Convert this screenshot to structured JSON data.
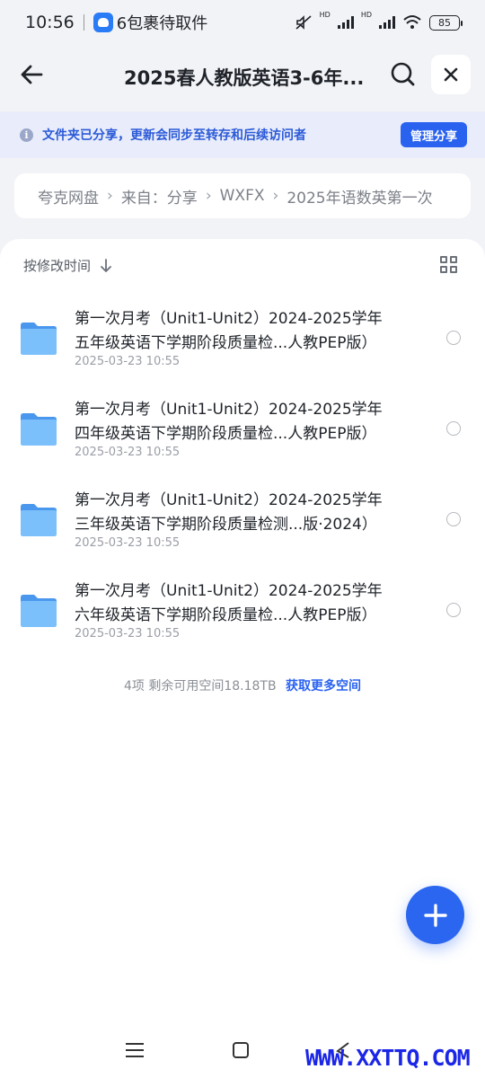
{
  "status_bar": {
    "time": "10:56",
    "notification": "6包裹待取件",
    "battery": "85",
    "hd1": "HD",
    "hd2": "HD"
  },
  "header": {
    "title": "2025春人教版英语3-6年..."
  },
  "notice": {
    "text": "文件夹已分享，更新会同步至转存和后续访问者",
    "button": "管理分享"
  },
  "breadcrumb": {
    "items": [
      "夸克网盘",
      "来自：分享",
      "WXFX",
      "2025年语数英第一次"
    ]
  },
  "sort": {
    "label": "按修改时间"
  },
  "files": [
    {
      "line1": "第一次月考（Unit1-Unit2）2024-2025学年",
      "line2": "五年级英语下学期阶段质量检...人教PEP版）",
      "date": "2025-03-23 10:55"
    },
    {
      "line1": "第一次月考（Unit1-Unit2）2024-2025学年",
      "line2": "四年级英语下学期阶段质量检...人教PEP版）",
      "date": "2025-03-23 10:55"
    },
    {
      "line1": "第一次月考（Unit1-Unit2）2024-2025学年",
      "line2": "三年级英语下学期阶段质量检测...版·2024）",
      "date": "2025-03-23 10:55"
    },
    {
      "line1": "第一次月考（Unit1-Unit2）2024-2025学年",
      "line2": "六年级英语下学期阶段质量检...人教PEP版）",
      "date": "2025-03-23 10:55"
    }
  ],
  "summary": {
    "count": "4项",
    "space": "剩余可用空间18.18TB",
    "link": "获取更多空间"
  },
  "watermark": "WWW.XXTTQ.COM",
  "colors": {
    "accent": "#2a62f0",
    "notice_bg": "#e9edfb",
    "folder": "#5aa9f5"
  }
}
